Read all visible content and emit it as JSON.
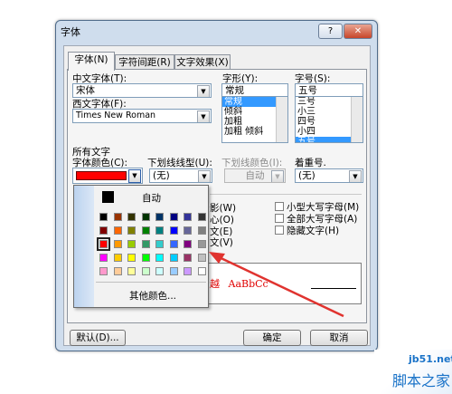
{
  "dialog": {
    "title": "字体",
    "help_label": "?",
    "close_label": "✕"
  },
  "tabs": [
    "字体(N)",
    "字符间距(R)",
    "文字效果(X)"
  ],
  "font": {
    "cn_label": "中文字体(T):",
    "cn_value": "宋体",
    "west_label": "西文字体(F):",
    "west_value": "Times New Roman",
    "style_label": "字形(Y):",
    "style_value": "常规",
    "style_items": [
      "常规",
      "倾斜",
      "加粗",
      "加粗 倾斜"
    ],
    "size_label": "字号(S):",
    "size_value": "五号",
    "size_items": [
      "三号",
      "小三",
      "四号",
      "小四",
      "五号"
    ]
  },
  "all_text": {
    "section_label": "所有文字",
    "color_label": "字体颜色(C):",
    "color_value": "#ff0000",
    "underline_label": "下划线线型(U):",
    "underline_value": "(无)",
    "underline_color_label": "下划线颜色(I):",
    "underline_color_value": "自动",
    "emphasis_label": "着重号.",
    "emphasis_value": "(无)"
  },
  "effects": {
    "left_partial": [
      "影(W)",
      "心(O)",
      "文(E)",
      "文(V)"
    ],
    "right": [
      "小型大写字母(M)",
      "全部大写字母(A)",
      "隐藏文字(H)"
    ]
  },
  "preview": {
    "text_partial": "越",
    "sample": "AaBbCc"
  },
  "palette": {
    "auto_label": "自动",
    "more_label": "其他颜色...",
    "rows": [
      [
        "#000000",
        "#993300",
        "#333300",
        "#003300",
        "#003366",
        "#000080",
        "#333399",
        "#333333"
      ],
      [
        "#800000",
        "#ff6600",
        "#808000",
        "#008000",
        "#008080",
        "#0000ff",
        "#666699",
        "#808080"
      ],
      [
        "#ff0000",
        "#ff9900",
        "#99cc00",
        "#339966",
        "#33cccc",
        "#3366ff",
        "#800080",
        "#999999"
      ],
      [
        "#ff00ff",
        "#ffcc00",
        "#ffff00",
        "#00ff00",
        "#00ffff",
        "#00ccff",
        "#993366",
        "#c0c0c0"
      ],
      [
        "#ff99cc",
        "#ffcc99",
        "#ffff99",
        "#ccffcc",
        "#ccffff",
        "#99ccff",
        "#cc99ff",
        "#ffffff"
      ]
    ]
  },
  "footer": {
    "default_label": "默认(D)...",
    "ok_label": "确定",
    "cancel_label": "取消"
  },
  "watermark": {
    "site": "jb51.net",
    "brand": "脚本之家"
  }
}
